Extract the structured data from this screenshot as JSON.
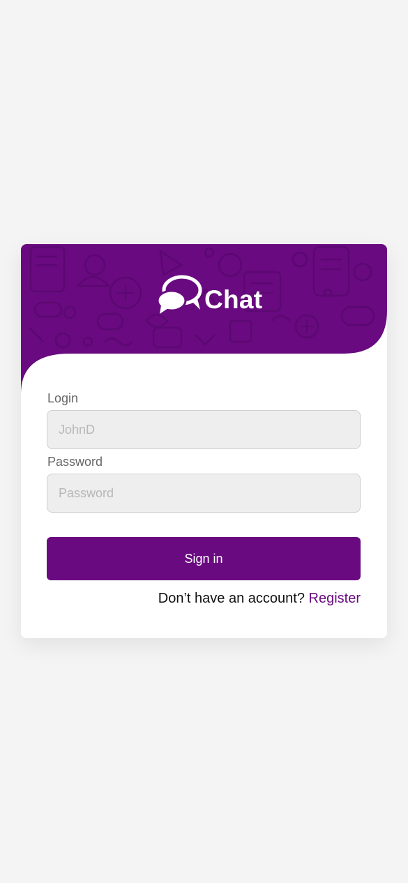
{
  "app": {
    "name": "Chat"
  },
  "colors": {
    "background": "#f4f4f4",
    "brand": "#690a80",
    "card": "#ffffff",
    "input_bg": "#eeeeee"
  },
  "form": {
    "login_label": "Login",
    "login_placeholder": "JohnD",
    "login_value": "",
    "password_label": "Password",
    "password_placeholder": "Password",
    "password_value": "",
    "submit_label": "Sign in"
  },
  "footer": {
    "prompt_text": "Don’t have an account?",
    "register_label": "Register"
  },
  "icons": {
    "logo": "chat-bubbles-icon",
    "header_pattern": "doodle-pattern"
  }
}
